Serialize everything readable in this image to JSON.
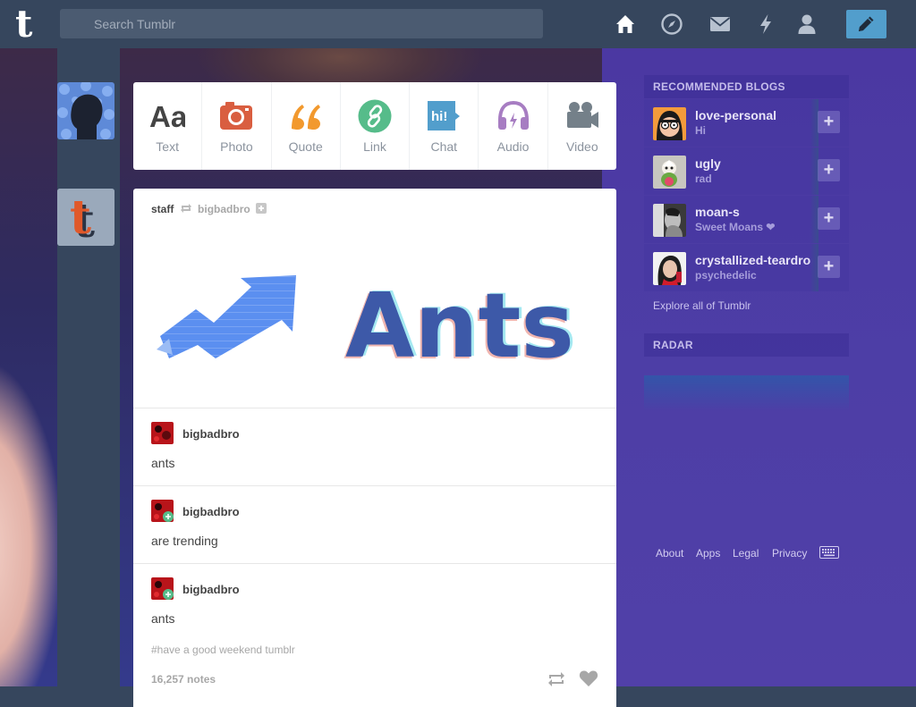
{
  "header": {
    "logo": "t",
    "search_placeholder": "Search Tumblr"
  },
  "post_types": [
    {
      "label": "Text",
      "color": "#444444"
    },
    {
      "label": "Photo",
      "color": "#d95e40"
    },
    {
      "label": "Quote",
      "color": "#f2992e"
    },
    {
      "label": "Link",
      "color": "#56bc8a"
    },
    {
      "label": "Chat",
      "color": "#529ecc"
    },
    {
      "label": "Audio",
      "color": "#a77dc2"
    },
    {
      "label": "Video",
      "color": "#748089"
    }
  ],
  "post": {
    "author": "staff",
    "reblogged_from": "bigbadbro",
    "image_text": "Ants",
    "replies": [
      {
        "name": "bigbadbro",
        "text": "ants"
      },
      {
        "name": "bigbadbro",
        "text": "are trending"
      },
      {
        "name": "bigbadbro",
        "text": "ants"
      }
    ],
    "tags": "#have a good weekend tumblr",
    "notes": "16,257 notes"
  },
  "sidebar": {
    "recommended_title": "RECOMMENDED BLOGS",
    "blogs": [
      {
        "name": "love-personal",
        "desc": "Hi"
      },
      {
        "name": "ugly",
        "desc": "rad"
      },
      {
        "name": "moan-s",
        "desc": "Sweet Moans ❤"
      },
      {
        "name": "crystallized-teardro",
        "desc": "psychedelic"
      }
    ],
    "explore": "Explore all of Tumblr",
    "radar_title": "RADAR",
    "footer": [
      "About",
      "Apps",
      "Legal",
      "Privacy"
    ]
  },
  "colors": {
    "navy": "#36465d",
    "accent": "#529ecc",
    "purple": "#4b3aa2"
  }
}
